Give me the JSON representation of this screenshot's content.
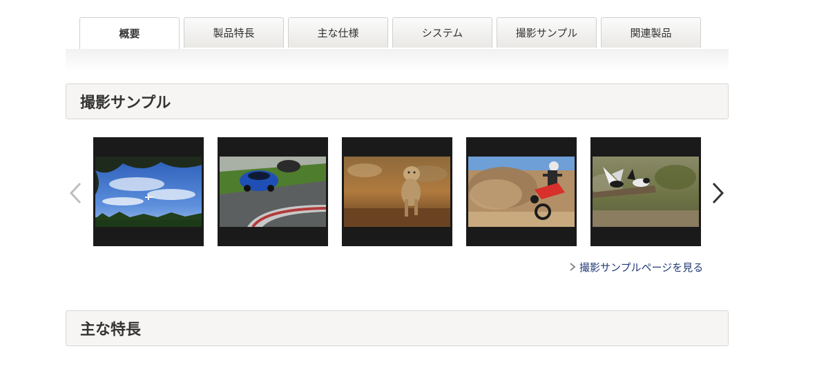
{
  "tabs": [
    {
      "label": "概要",
      "active": true
    },
    {
      "label": "製品特長",
      "active": false
    },
    {
      "label": "主な仕様",
      "active": false
    },
    {
      "label": "システム",
      "active": false
    },
    {
      "label": "撮影サンプル",
      "active": false
    },
    {
      "label": "関連製品",
      "active": false
    }
  ],
  "sample_section": {
    "title": "撮影サンプル",
    "more_link": "撮影サンプルページを見る"
  },
  "features_section": {
    "title": "主な特長"
  },
  "carousel": {
    "prev_icon": "chevron-left-icon",
    "next_icon": "chevron-right-icon",
    "thumbnails": [
      {
        "subject": "airplane-sky"
      },
      {
        "subject": "race-car"
      },
      {
        "subject": "cheetah-cub"
      },
      {
        "subject": "motocross"
      },
      {
        "subject": "birds"
      }
    ]
  },
  "colors": {
    "link": "#233a78",
    "thumb_bg": "#1a1a1a",
    "header_bg": "#f6f5f3"
  }
}
